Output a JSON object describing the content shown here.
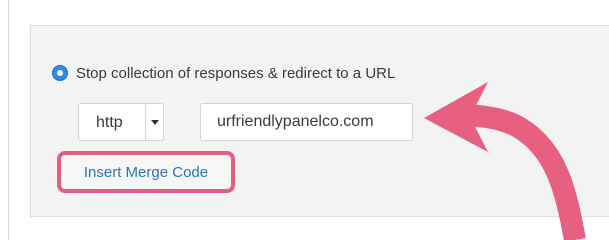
{
  "redirect_option": {
    "label": "Stop collection of responses & redirect to a URL",
    "selected": true
  },
  "protocol_select": {
    "value": "http"
  },
  "url_field": {
    "value": "urfriendlypanelco.com"
  },
  "merge_code_button": {
    "label": "Insert Merge Code"
  },
  "annotation": {
    "arrow_color": "#e8607f",
    "highlight_color": "#e2607f"
  }
}
